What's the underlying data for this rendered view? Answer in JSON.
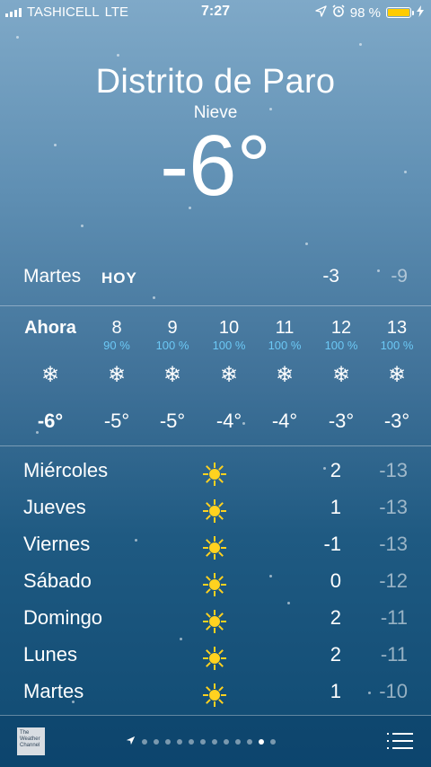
{
  "status_bar": {
    "carrier": "TASHICELL",
    "network": "LTE",
    "time": "7:27",
    "battery_percent": "98 %",
    "battery_level": 0.98,
    "icons": [
      "location-arrow-icon",
      "alarm-icon",
      "battery-icon",
      "charging-bolt-icon"
    ]
  },
  "location": {
    "city": "Distrito de Paro",
    "condition": "Nieve",
    "temperature": "-6°"
  },
  "today": {
    "day": "Martes",
    "label": "HOY",
    "high": "-3",
    "low": "-9"
  },
  "hourly": [
    {
      "hour": "Ahora",
      "precip": "",
      "icon": "snowflake-icon",
      "temp": "-6°"
    },
    {
      "hour": "8",
      "precip": "90 %",
      "icon": "snowflake-icon",
      "temp": "-5°"
    },
    {
      "hour": "9",
      "precip": "100 %",
      "icon": "snowflake-icon",
      "temp": "-5°"
    },
    {
      "hour": "10",
      "precip": "100 %",
      "icon": "snowflake-icon",
      "temp": "-4°"
    },
    {
      "hour": "11",
      "precip": "100 %",
      "icon": "snowflake-icon",
      "temp": "-4°"
    },
    {
      "hour": "12",
      "precip": "100 %",
      "icon": "snowflake-icon",
      "temp": "-3°"
    },
    {
      "hour": "13",
      "precip": "100 %",
      "icon": "snowflake-icon",
      "temp": "-3°"
    }
  ],
  "daily": [
    {
      "day": "Miércoles",
      "icon": "sun-icon",
      "high": "2",
      "low": "-13"
    },
    {
      "day": "Jueves",
      "icon": "sun-icon",
      "high": "1",
      "low": "-13"
    },
    {
      "day": "Viernes",
      "icon": "sun-icon",
      "high": "-1",
      "low": "-13"
    },
    {
      "day": "Sábado",
      "icon": "sun-icon",
      "high": "0",
      "low": "-12"
    },
    {
      "day": "Domingo",
      "icon": "sun-icon",
      "high": "2",
      "low": "-11"
    },
    {
      "day": "Lunes",
      "icon": "sun-icon",
      "high": "2",
      "low": "-11"
    },
    {
      "day": "Martes",
      "icon": "sun-icon",
      "high": "1",
      "low": "-10"
    }
  ],
  "footer": {
    "logo_text": "The Weather Channel",
    "page_count": 12,
    "active_page": 11
  },
  "colors": {
    "precip": "#6cc8f5",
    "battery": "#ffcc00",
    "sun": "#ffd21f"
  }
}
